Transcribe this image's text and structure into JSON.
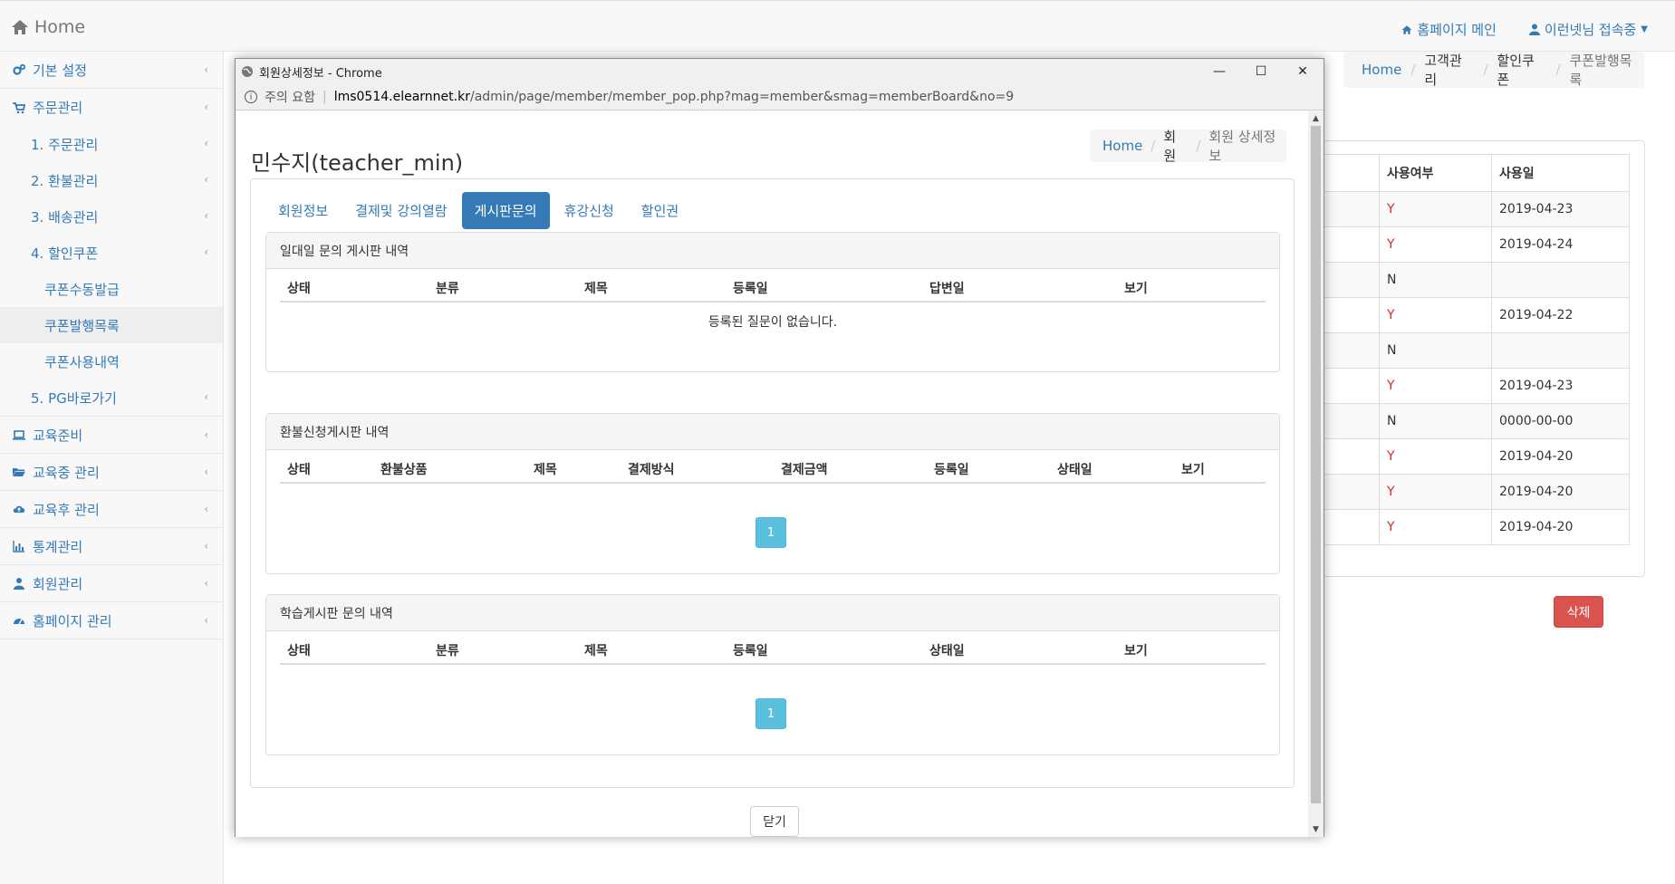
{
  "navbar": {
    "brand": "Home",
    "homepage_link": "홈페이지 메인",
    "user_menu": "이런넷님 접속중"
  },
  "sidebar": {
    "items": [
      {
        "label": "기본 설정",
        "icon": "gears-icon"
      },
      {
        "label": "주문관리",
        "icon": "cart-icon"
      },
      {
        "label": "1. 주문관리"
      },
      {
        "label": "2. 환불관리"
      },
      {
        "label": "3. 배송관리"
      },
      {
        "label": "4. 할인쿠폰"
      },
      {
        "label": "쿠폰수동발급"
      },
      {
        "label": "쿠폰발행목록"
      },
      {
        "label": "쿠폰사용내역"
      },
      {
        "label": "5. PG바로가기"
      },
      {
        "label": "교육준비",
        "icon": "laptop-icon"
      },
      {
        "label": "교육중 관리",
        "icon": "folder-open-icon"
      },
      {
        "label": "교육후 관리",
        "icon": "cloud-upload-icon"
      },
      {
        "label": "통계관리",
        "icon": "bar-chart-icon"
      },
      {
        "label": "회원관리",
        "icon": "user-icon"
      },
      {
        "label": "홈페이지 관리",
        "icon": "dashboard-icon"
      }
    ]
  },
  "bg_page": {
    "breadcrumb": [
      "Home",
      "고객관리",
      "할인쿠폰",
      "쿠폰발행목록"
    ],
    "table_headers": [
      "사용여부",
      "사용일"
    ],
    "rows": [
      [
        "Y",
        "2019-04-23"
      ],
      [
        "Y",
        "2019-04-24"
      ],
      [
        "N",
        ""
      ],
      [
        "Y",
        "2019-04-22"
      ],
      [
        "N",
        ""
      ],
      [
        "Y",
        "2019-04-23"
      ],
      [
        "N",
        "0000-00-00"
      ],
      [
        "Y",
        "2019-04-20"
      ],
      [
        "Y",
        "2019-04-20"
      ],
      [
        "Y",
        "2019-04-20"
      ]
    ],
    "delete_button": "삭제"
  },
  "popup": {
    "window_title": "회원상세정보 - Chrome",
    "security_label": "주의 요함",
    "url_host": "lms0514.elearnnet.kr",
    "url_path": "/admin/page/member/member_pop.php?mag=member&smag=memberBoard&no=9",
    "member_name": "민수지(teacher_min)",
    "breadcrumb": [
      "Home",
      "회원",
      "회원 상세정보"
    ],
    "tabs": [
      "회원정보",
      "결제및 강의열람",
      "게시판문의",
      "휴강신청",
      "할인권"
    ],
    "active_tab": "게시판문의",
    "panels": [
      {
        "title": "일대일 문의 게시판 내역",
        "headers": [
          "상태",
          "분류",
          "제목",
          "등록일",
          "답변일",
          "보기"
        ],
        "empty_text": "등록된 질문이 없습니다."
      },
      {
        "title": "환불신청게시판 내역",
        "headers": [
          "상태",
          "환불상품",
          "제목",
          "결제방식",
          "결제금액",
          "등록일",
          "상태일",
          "보기"
        ],
        "page": "1"
      },
      {
        "title": "학습게시판 문의 내역",
        "headers": [
          "상태",
          "분류",
          "제목",
          "등록일",
          "상태일",
          "보기"
        ],
        "page": "1"
      }
    ],
    "close_button": "닫기"
  },
  "colors": {
    "link": "#337ab7",
    "active_tab_bg": "#337ab7",
    "pager_bg": "#5bc0de",
    "danger": "#d9534f",
    "yes_text": "#c9302c"
  }
}
